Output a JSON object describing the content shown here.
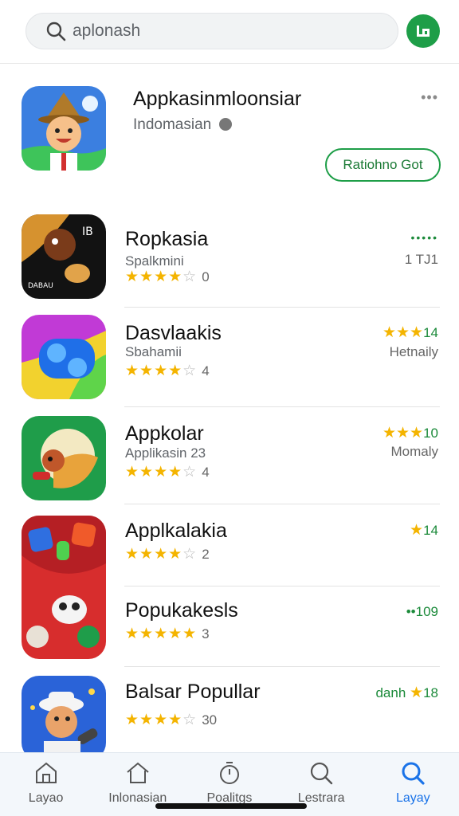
{
  "search": {
    "value": "aplonash"
  },
  "featured": {
    "title": "Appkasinmloonsiar",
    "subtitle": "Indomasian",
    "button_label": "Ratiohno Got",
    "more_label": "•••"
  },
  "apps": [
    {
      "title": "Ropkasia",
      "subtitle": "Spalkmini",
      "rating": 4,
      "rating_label": "0",
      "right_top": "•••••",
      "right_bottom": "1    TJ1"
    },
    {
      "title": "Dasvlaakis",
      "subtitle": "Sbahamii",
      "rating": 4,
      "rating_label": "4",
      "right_top": "14",
      "right_top_stars": "★★★",
      "right_bottom": "Hetnaily"
    },
    {
      "title": "Appkolar",
      "subtitle": "Applikasin 23",
      "rating": 4,
      "rating_label": "4",
      "right_top": "10",
      "right_top_stars": "★★★",
      "right_bottom": "Momaly"
    },
    {
      "title": "Applkalakia",
      "rating": 4,
      "rating_label": "2",
      "right_top": "14",
      "right_top_stars": "★"
    },
    {
      "title": "Popukakesls",
      "rating": 5,
      "rating_label": "3",
      "right_top": "••109"
    },
    {
      "title": "Balsar Popullar",
      "rating": 4,
      "rating_label": "30",
      "right_top": "18",
      "right_top_prefix": "danh",
      "right_top_stars": "★"
    }
  ],
  "nav": [
    {
      "label": "Layao",
      "icon": "home-outline-icon"
    },
    {
      "label": "Inlonasian",
      "icon": "home-icon"
    },
    {
      "label": "Poalitgs",
      "icon": "timer-icon"
    },
    {
      "label": "Lestrara",
      "icon": "search-icon"
    },
    {
      "label": "Layay",
      "icon": "search-active-icon"
    }
  ],
  "colors": {
    "accent": "#1e9e48",
    "star": "#f4b400",
    "nav_active": "#1a73e8"
  }
}
